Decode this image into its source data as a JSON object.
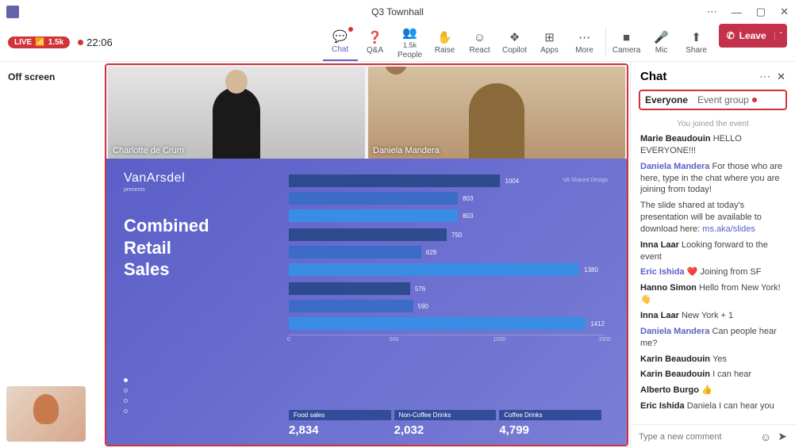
{
  "window": {
    "title": "Q3 Townhall"
  },
  "status": {
    "live_label": "LIVE",
    "viewer_count": "1.5k",
    "time": "22:06"
  },
  "toolbar": {
    "chat": "Chat",
    "qa": "Q&A",
    "people_count": "1.5k",
    "people": "People",
    "raise": "Raise",
    "react": "React",
    "copilot": "Copilot",
    "apps": "Apps",
    "more": "More",
    "camera": "Camera",
    "mic": "Mic",
    "share": "Share",
    "leave": "Leave"
  },
  "left_rail": {
    "off_screen": "Off screen"
  },
  "videos": {
    "p1": "Charlotte de Crum",
    "p2": "Daniela Mandera"
  },
  "slide": {
    "brand": "VanArsdel",
    "presents": "presents",
    "heading1": "Combined",
    "heading2": "Retail",
    "heading3": "Sales",
    "meta": "VA Shared Design",
    "axis": {
      "a": "0",
      "b": "500",
      "c": "1000",
      "d": "1500"
    },
    "totals": {
      "food_label": "Food sales",
      "food": "2,834",
      "ncd_label": "Non-Coffee Drinks",
      "ncd": "2,032",
      "coffee_label": "Coffee Drinks",
      "coffee": "4,799"
    }
  },
  "chart_data": {
    "type": "bar",
    "orientation": "horizontal",
    "groups": 3,
    "series": [
      {
        "name": "Food sales",
        "color": "#2f4b8f",
        "values": [
          1004,
          750,
          576
        ]
      },
      {
        "name": "Non-Coffee Drinks",
        "color": "#3d6bc8",
        "values": [
          803,
          629,
          590
        ]
      },
      {
        "name": "Coffee Drinks",
        "color": "#3a8de4",
        "values": [
          803,
          1380,
          1412
        ]
      }
    ],
    "xlim": [
      0,
      1500
    ],
    "xticks": [
      0,
      500,
      1000,
      1500
    ],
    "totals": {
      "Food sales": 2834,
      "Non-Coffee Drinks": 2032,
      "Coffee Drinks": 4799
    },
    "title": "Combined Retail Sales"
  },
  "chat": {
    "title": "Chat",
    "tab_everyone": "Everyone",
    "tab_group": "Event group",
    "system": "You joined the event",
    "messages": [
      {
        "author": "Marie Beaudouin",
        "link": false,
        "text": "HELLO EVERYONE!!!"
      },
      {
        "author": "Daniela Mandera",
        "link": true,
        "text": "For those who are here, type in the chat where you are joining from today!"
      },
      {
        "author": "",
        "link": false,
        "text": "The slide shared at today's presentation will be available to download here: ",
        "url": "ms.aka/slides"
      },
      {
        "author": "Inna Laar",
        "link": false,
        "text": "Looking forward to the event"
      },
      {
        "author": "Eric Ishida",
        "link": true,
        "text": "❤️  Joining from SF"
      },
      {
        "author": "Hanno Simon",
        "link": false,
        "text": "Hello from New York!  👋"
      },
      {
        "author": "Inna Laar",
        "link": false,
        "text": "New York + 1"
      },
      {
        "author": "Daniela Mandera",
        "link": true,
        "text": "Can people hear me?"
      },
      {
        "author": "Karin Beaudouin",
        "link": false,
        "text": "Yes"
      },
      {
        "author": "Karin Beaudouin",
        "link": false,
        "text": "I can hear"
      },
      {
        "author": "Alberto Burgo",
        "link": false,
        "text": "👍"
      },
      {
        "author": "Eric Ishida",
        "link": false,
        "text": "Daniela I can hear you"
      }
    ],
    "compose_placeholder": "Type a new comment"
  }
}
